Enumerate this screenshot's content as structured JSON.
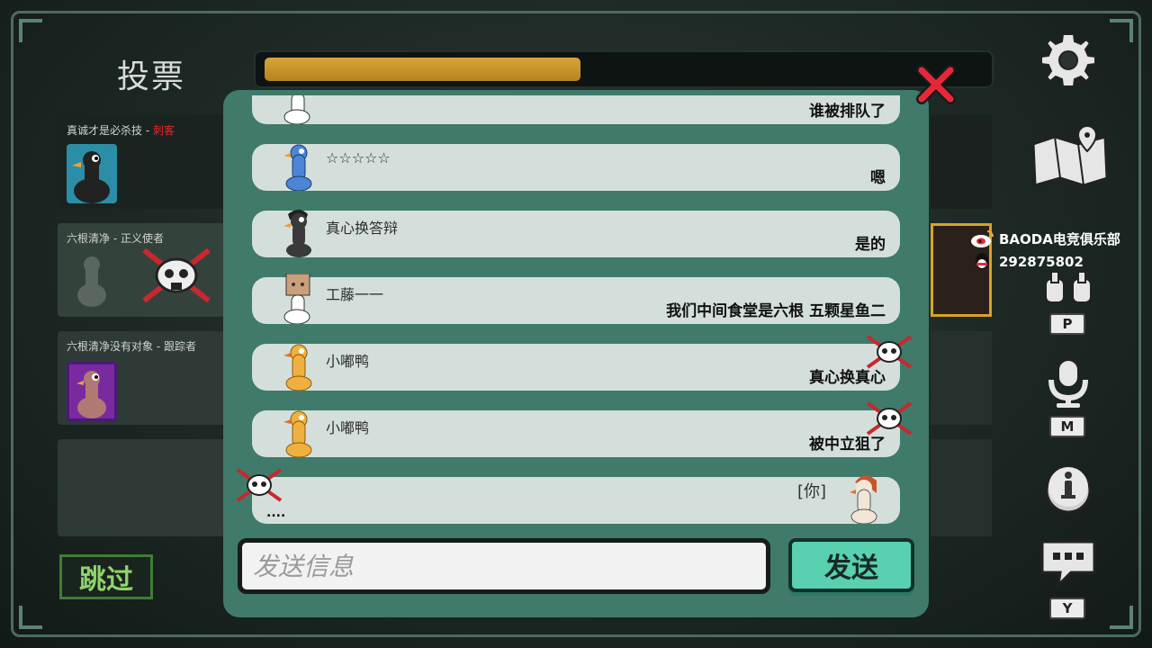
{
  "header": {
    "vote_title": "投票",
    "timer_progress": 0.44
  },
  "players": [
    {
      "name": "真诚才是必杀技 - ",
      "role": "刺客",
      "role_color": "#e02a2a"
    },
    {
      "name": "六根清净 - 正义使者"
    },
    {
      "name": "六根清净没有对象 - 跟踪者"
    }
  ],
  "skip_label": "跳过",
  "chat": {
    "messages": [
      {
        "nick": "",
        "text": "谁被排队了"
      },
      {
        "nick": "☆☆☆☆☆",
        "text": "嗯"
      },
      {
        "nick": "真心换答辩",
        "text": "是的"
      },
      {
        "nick": "工藤一一",
        "text": "我们中间食堂是六根 五颗星鱼二"
      },
      {
        "nick": "小嘟鸭",
        "text": "真心换真心"
      },
      {
        "nick": "小嘟鸭",
        "text": "被中立狙了"
      },
      {
        "you_tag": "[你]",
        "text": "...."
      }
    ],
    "input_placeholder": "发送信息",
    "input_value": "",
    "send_label": "发送"
  },
  "toolbar": {
    "settings_icon": "gear-icon",
    "map_icon": "map-icon",
    "p_key": "P",
    "m_key": "M",
    "y_key": "Y"
  },
  "sponsor": {
    "weibo": "BAODA电竞俱乐部",
    "qq": "292875802"
  },
  "colors": {
    "panel": "#3f7a6a",
    "timer": "#d9a437",
    "send": "#59d0b0",
    "close": "#e8283a"
  }
}
